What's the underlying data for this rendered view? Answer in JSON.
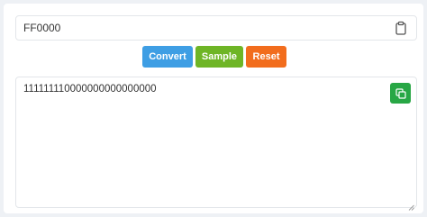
{
  "input": {
    "value": "FF0000",
    "paste_icon": "clipboard-icon"
  },
  "buttons": {
    "convert_label": "Convert",
    "sample_label": "Sample",
    "reset_label": "Reset"
  },
  "output": {
    "value": "111111110000000000000000",
    "copy_icon": "copy-icon"
  },
  "colors": {
    "convert": "#3e9ee4",
    "sample": "#6eb526",
    "reset": "#f26d1d",
    "copy": "#28a745"
  }
}
